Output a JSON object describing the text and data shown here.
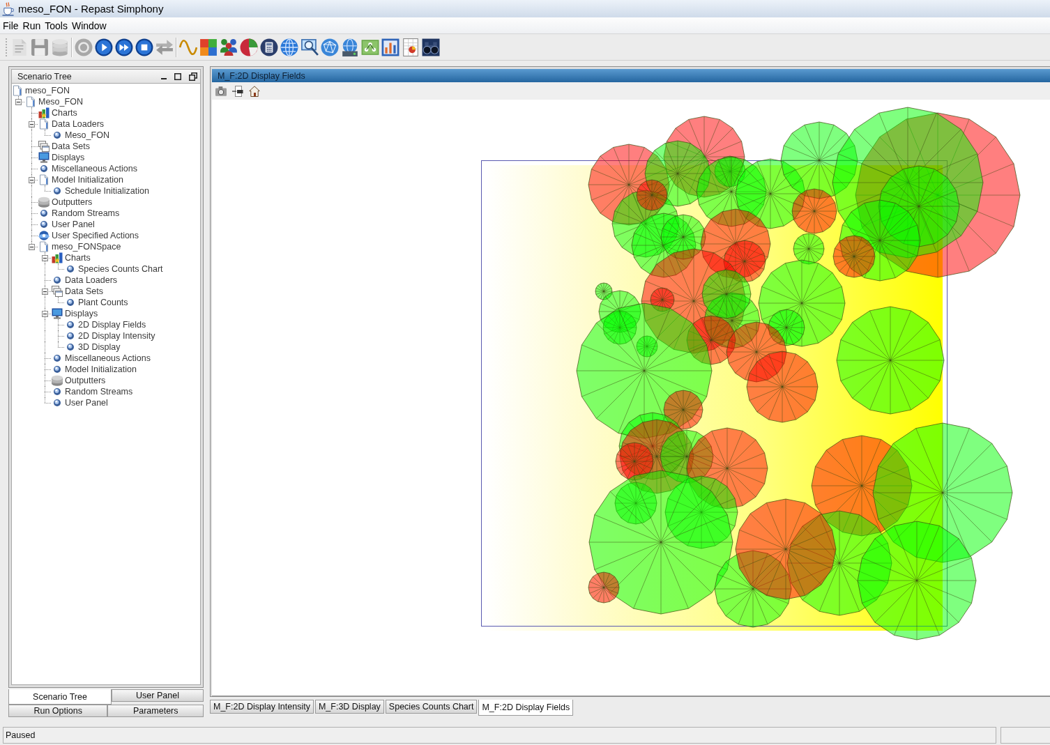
{
  "window": {
    "title": "meso_FON - Repast Simphony"
  },
  "menu": [
    "File",
    "Run",
    "Tools",
    "Window"
  ],
  "toolbar_groups": [
    {
      "buttons": [
        {
          "kind": "open",
          "disabled": true
        },
        {
          "kind": "save",
          "disabled": true
        },
        {
          "kind": "database",
          "disabled": true
        }
      ]
    },
    {
      "buttons": [
        {
          "kind": "initialize",
          "disabled": true
        },
        {
          "kind": "play",
          "disabled": false
        },
        {
          "kind": "step",
          "disabled": false
        },
        {
          "kind": "stop",
          "disabled": false
        },
        {
          "kind": "reset",
          "disabled": true
        }
      ]
    },
    {
      "buttons": [
        {
          "kind": "wave",
          "disabled": false
        },
        {
          "kind": "palette",
          "disabled": false
        },
        {
          "kind": "people",
          "disabled": false
        },
        {
          "kind": "pie",
          "disabled": false
        },
        {
          "kind": "calculator",
          "disabled": false
        },
        {
          "kind": "globe",
          "disabled": false
        },
        {
          "kind": "magnifier",
          "disabled": false
        },
        {
          "kind": "network-globe",
          "disabled": false
        },
        {
          "kind": "server-globe",
          "disabled": false
        },
        {
          "kind": "network",
          "disabled": false
        },
        {
          "kind": "bar-chart",
          "disabled": false
        },
        {
          "kind": "sheet",
          "disabled": false
        },
        {
          "kind": "binoculars",
          "disabled": false
        }
      ]
    }
  ],
  "scenario_panel": {
    "title": "Scenario Tree",
    "tree": {
      "label": "meso_FON",
      "kind": "document",
      "children": [
        {
          "label": "Meso_FON",
          "kind": "document",
          "expanded": true,
          "children": [
            {
              "label": "Charts",
              "kind": "charts"
            },
            {
              "label": "Data Loaders",
              "kind": "document",
              "expanded": true,
              "children": [
                {
                  "label": "Meso_FON",
                  "kind": "action"
                }
              ]
            },
            {
              "label": "Data Sets",
              "kind": "data-sets"
            },
            {
              "label": "Displays",
              "kind": "display"
            },
            {
              "label": "Miscellaneous Actions",
              "kind": "action"
            },
            {
              "label": "Model Initialization",
              "kind": "document",
              "expanded": true,
              "children": [
                {
                  "label": "Schedule Initialization",
                  "kind": "action"
                }
              ]
            },
            {
              "label": "Outputters",
              "kind": "outputters"
            },
            {
              "label": "Random Streams",
              "kind": "action"
            },
            {
              "label": "User Panel",
              "kind": "action"
            },
            {
              "label": "User Specified Actions",
              "kind": "user-actions"
            },
            {
              "label": "meso_FONSpace",
              "kind": "document",
              "expanded": true,
              "children": [
                {
                  "label": "Charts",
                  "kind": "charts",
                  "expanded": true,
                  "children": [
                    {
                      "label": "Species Counts Chart",
                      "kind": "action"
                    }
                  ]
                },
                {
                  "label": "Data Loaders",
                  "kind": "action"
                },
                {
                  "label": "Data Sets",
                  "kind": "data-sets",
                  "expanded": true,
                  "children": [
                    {
                      "label": "Plant Counts",
                      "kind": "action"
                    }
                  ]
                },
                {
                  "label": "Displays",
                  "kind": "display",
                  "expanded": true,
                  "children": [
                    {
                      "label": "2D Display Fields",
                      "kind": "action"
                    },
                    {
                      "label": "2D Display Intensity",
                      "kind": "action"
                    },
                    {
                      "label": "3D Display",
                      "kind": "action"
                    }
                  ]
                },
                {
                  "label": "Miscellaneous Actions",
                  "kind": "action"
                },
                {
                  "label": "Model Initialization",
                  "kind": "action"
                },
                {
                  "label": "Outputters",
                  "kind": "outputters"
                },
                {
                  "label": "Random Streams",
                  "kind": "action"
                },
                {
                  "label": "User Panel",
                  "kind": "action"
                }
              ]
            }
          ]
        }
      ]
    }
  },
  "left_tab_rows": [
    {
      "tabs": [
        {
          "label": "Scenario Tree",
          "selected": true
        },
        {
          "label": "User Panel",
          "selected": false
        }
      ]
    },
    {
      "tabs": [
        {
          "label": "Run Options",
          "selected": false
        },
        {
          "label": "Parameters",
          "selected": false
        }
      ]
    }
  ],
  "display_panel": {
    "title": "M_F:2D Display Fields",
    "tools": [
      {
        "kind": "camera"
      },
      {
        "kind": "export"
      },
      {
        "kind": "home"
      }
    ]
  },
  "display_tabs": [
    {
      "label": "M_F:2D Display Intensity",
      "selected": false
    },
    {
      "label": "M_F:3D Display",
      "selected": false
    },
    {
      "label": "Species Counts Chart",
      "selected": false
    },
    {
      "label": "M_F:2D Display Fields",
      "selected": true
    }
  ],
  "status_bar": {
    "text": "Paused"
  }
}
